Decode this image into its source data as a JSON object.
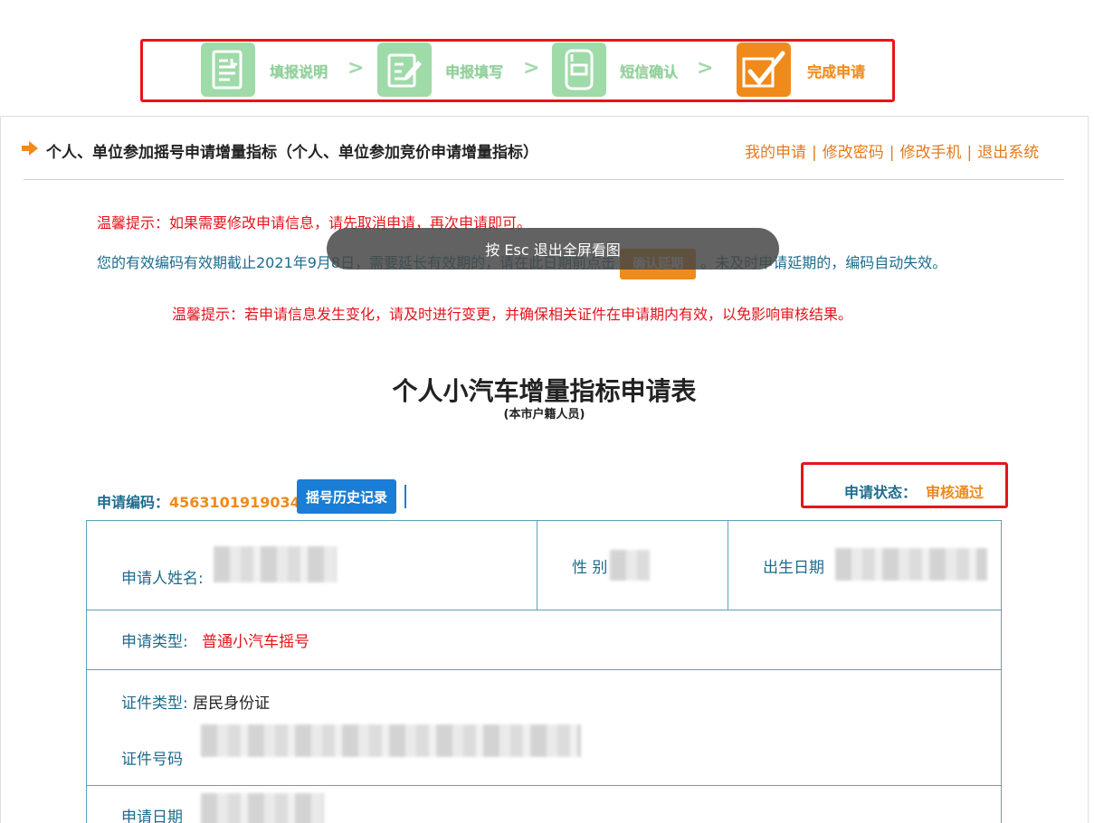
{
  "steps": [
    {
      "label": "填报说明",
      "icon": "document-icon",
      "done": false
    },
    {
      "label": "申报填写",
      "icon": "edit-form-icon",
      "done": false
    },
    {
      "label": "短信确认",
      "icon": "phone-message-icon",
      "done": false
    },
    {
      "label": "完成申请",
      "icon": "checkmark-icon",
      "done": true
    }
  ],
  "step_separator": ">",
  "header": {
    "title": "个人、单位参加摇号申请增量指标（个人、单位参加竞价申请增量指标）",
    "links": [
      "我的申请",
      "修改密码",
      "修改手机",
      "退出系统"
    ],
    "link_separator": "|"
  },
  "notices": {
    "tip1": "温馨提示：如果需要修改申请信息，请先取消申请，再次申请即可。",
    "validity_before": "您的有效编码有效期截止2021年9月8日，需要延长有效期的，请在此日期前点击",
    "extend_button": "确认延期",
    "validity_after": "。未及时申请延期的，编码自动失效。",
    "tip2": "温馨提示：若申请信息发生变化，请及时进行变更，并确保相关证件在申请期内有效，以免影响审核结果。"
  },
  "overlay": {
    "fullscreen_hint": "按 Esc 退出全屏看图"
  },
  "form": {
    "title": "个人小汽车增量指标申请表",
    "subtitle": "(本市户籍人员)",
    "code_label": "申请编码：",
    "code_value": "4563101919034",
    "history_button": "摇号历史记录",
    "status_label": "申请状态：",
    "status_value": "审核通过",
    "fields": {
      "name_label": "申请人姓名:",
      "gender_label": "性 别",
      "birth_label": "出生日期",
      "type_label": "申请类型:",
      "type_value": "普通小汽车摇号",
      "id_type_label": "证件类型:",
      "id_type_value": "居民身份证",
      "id_number_label": "证件号码",
      "date_label": "申请日期"
    }
  },
  "colors": {
    "accent_orange": "#f08a1a",
    "link_orange": "#e47a1c",
    "label_blue": "#1d6c8d",
    "warning_red": "#e3131b",
    "step_green": "#9fdaa9",
    "button_blue": "#1a7ed6",
    "highlight_red": "#e8141c"
  }
}
